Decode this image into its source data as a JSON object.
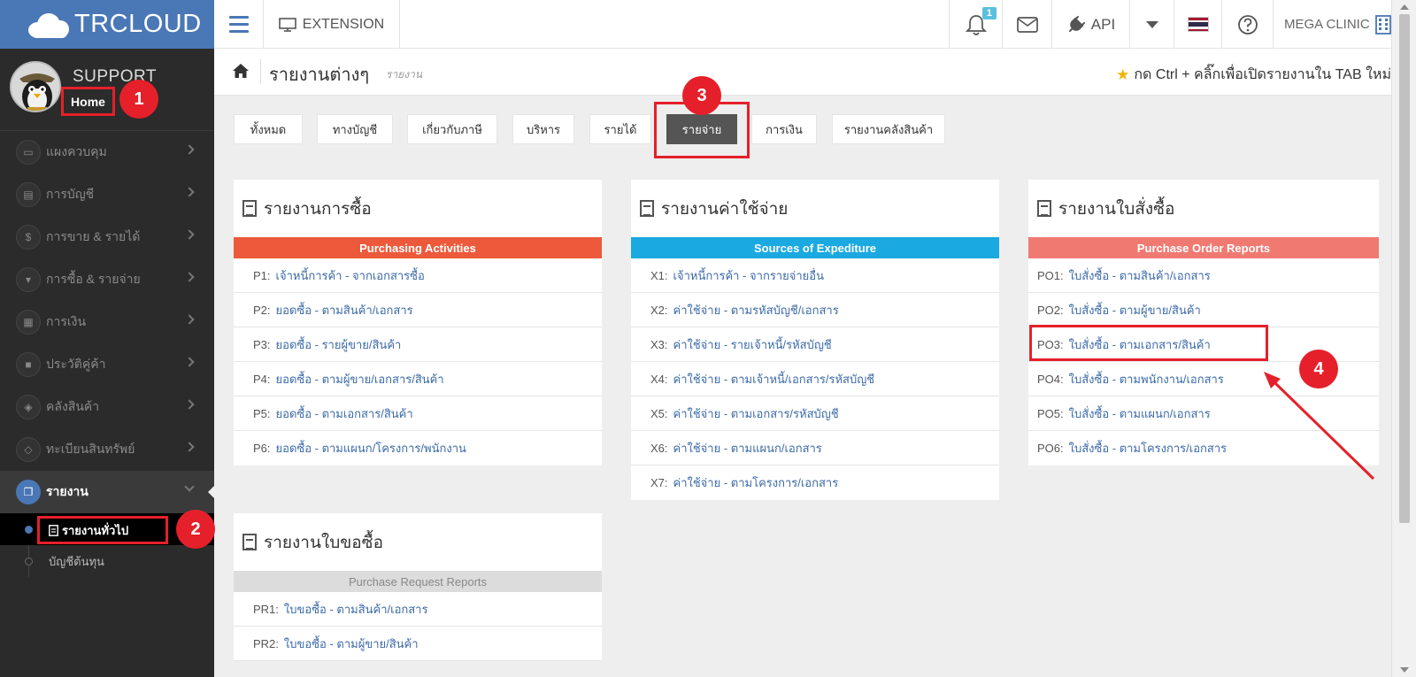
{
  "brand": {
    "word": "TRCLOUD"
  },
  "topbar": {
    "extension_label": "EXTENSION",
    "notification_count": "1",
    "api_label": "API",
    "company_label": "MEGA CLINIC"
  },
  "profile": {
    "name": "SUPPORT",
    "home_label": "Home"
  },
  "sidebar": {
    "items": [
      {
        "label": "แผงควบคุม",
        "icon": "monitor-icon"
      },
      {
        "label": "การบัญชี",
        "icon": "book-icon"
      },
      {
        "label": "การขาย & รายได้",
        "icon": "dollar-icon"
      },
      {
        "label": "การซื้อ & รายจ่าย",
        "icon": "cart-icon"
      },
      {
        "label": "การเงิน",
        "icon": "calendar-icon"
      },
      {
        "label": "ประวัติคู่ค้า",
        "icon": "contact-icon"
      },
      {
        "label": "คลังสินค้า",
        "icon": "cubes-icon"
      },
      {
        "label": "ทะเบียนสินทรัพย์",
        "icon": "diamond-icon"
      },
      {
        "label": "รายงาน",
        "icon": "copy-icon"
      }
    ],
    "sub_items": [
      {
        "label": "รายงานทั่วไป"
      },
      {
        "label": "บัญชีต้นทุน"
      }
    ]
  },
  "page": {
    "title": "รายงานต่างๆ",
    "subtitle": "รายงาน",
    "hint": "กด Ctrl + คลิ๊กเพื่อเปิดรายงานใน TAB ใหม่"
  },
  "tabs": [
    {
      "label": "ทั้งหมด"
    },
    {
      "label": "ทางบัญชี"
    },
    {
      "label": "เกี่ยวกับภาษี"
    },
    {
      "label": "บริหาร"
    },
    {
      "label": "รายได้"
    },
    {
      "label": "รายจ่าย"
    },
    {
      "label": "การเงิน"
    },
    {
      "label": "รายงานคลังสินค้า"
    }
  ],
  "cards": {
    "purchase": {
      "title": "รายงานการซื้อ",
      "band": "Purchasing Activities",
      "band_color": "#ec5a3b",
      "rows": [
        {
          "code": "P1:",
          "label": "เจ้าหนี้การค้า - จากเอกสารซื้อ"
        },
        {
          "code": "P2:",
          "label": "ยอดซื้อ - ตามสินค้า/เอกสาร"
        },
        {
          "code": "P3:",
          "label": "ยอดซื้อ - รายผู้ขาย/สินค้า"
        },
        {
          "code": "P4:",
          "label": "ยอดซื้อ - ตามผู้ขาย/เอกสาร/สินค้า"
        },
        {
          "code": "P5:",
          "label": "ยอดซื้อ - ตามเอกสาร/สินค้า"
        },
        {
          "code": "P6:",
          "label": "ยอดซื้อ - ตามแผนก/โครงการ/พนักงาน"
        }
      ]
    },
    "expense": {
      "title": "รายงานค่าใช้จ่าย",
      "band": "Sources of Expediture",
      "band_color": "#1aa9e0",
      "rows": [
        {
          "code": "X1:",
          "label": "เจ้าหนี้การค้า - จากรายจ่ายอื่น"
        },
        {
          "code": "X2:",
          "label": "ค่าใช้จ่าย - ตามรหัสบัญชี/เอกสาร"
        },
        {
          "code": "X3:",
          "label": "ค่าใช้จ่าย - รายเจ้าหนี้/รหัสบัญชี"
        },
        {
          "code": "X4:",
          "label": "ค่าใช้จ่าย - ตามเจ้าหนี้/เอกสาร/รหัสบัญชี"
        },
        {
          "code": "X5:",
          "label": "ค่าใช้จ่าย - ตามเอกสาร/รหัสบัญชี"
        },
        {
          "code": "X6:",
          "label": "ค่าใช้จ่าย - ตามแผนก/เอกสาร"
        },
        {
          "code": "X7:",
          "label": "ค่าใช้จ่าย - ตามโครงการ/เอกสาร"
        }
      ]
    },
    "po": {
      "title": "รายงานใบสั่งซื้อ",
      "band": "Purchase Order Reports",
      "band_color": "#f07a72",
      "rows": [
        {
          "code": "PO1:",
          "label": "ใบสั่งซื้อ - ตามสินค้า/เอกสาร"
        },
        {
          "code": "PO2:",
          "label": "ใบสั่งซื้อ - ตามผู้ขาย/สินค้า"
        },
        {
          "code": "PO3:",
          "label": "ใบสั่งซื้อ - ตามเอกสาร/สินค้า"
        },
        {
          "code": "PO4:",
          "label": "ใบสั่งซื้อ - ตามพนักงาน/เอกสาร"
        },
        {
          "code": "PO5:",
          "label": "ใบสั่งซื้อ - ตามแผนก/เอกสาร"
        },
        {
          "code": "PO6:",
          "label": "ใบสั่งซื้อ - ตามโครงการ/เอกสาร"
        }
      ]
    },
    "pr": {
      "title": "รายงานใบขอซื้อ",
      "band": "Purchase Request Reports",
      "band_color": "#dcdcdc",
      "rows": [
        {
          "code": "PR1:",
          "label": "ใบขอซื้อ - ตามสินค้า/เอกสาร"
        },
        {
          "code": "PR2:",
          "label": "ใบขอซื้อ - ตามผู้ขาย/สินค้า"
        }
      ]
    }
  },
  "annotations": {
    "step1": "1",
    "step2": "2",
    "step3": "3",
    "step4": "4",
    "color": "#e5202a"
  }
}
